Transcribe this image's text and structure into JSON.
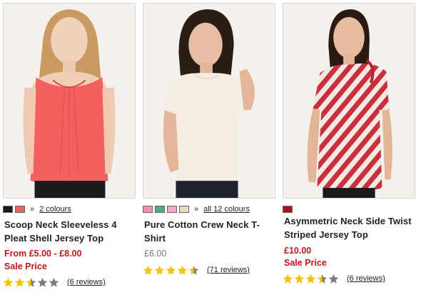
{
  "products": [
    {
      "swatches": [
        "#1a1a1a",
        "#f2605f"
      ],
      "colours_link": "2 colours",
      "title_line1": "Scoop Neck Sleeveless 4",
      "title_line2": "Pleat Shell Jersey Top",
      "price": "From £5.00 - £8.00",
      "sale": "Sale Price",
      "rating": 2.5,
      "reviews": "(6 reviews)"
    },
    {
      "swatches": [
        "#f48fb1",
        "#4caf7a",
        "#f7a8c4",
        "#e9d9c5"
      ],
      "colours_link": "all 12 colours",
      "title_line1": "Pure Cotton Crew Neck T-",
      "title_line2": "Shirt",
      "price": "£6.00",
      "rating": 4.5,
      "reviews": "(71 reviews)"
    },
    {
      "swatches": [
        "#b01020"
      ],
      "title_line1": "Asymmetric Neck Side Twist",
      "title_line2": "Striped Jersey Top",
      "price": "£10.00",
      "sale": "Sale Price",
      "rating": 3.5,
      "reviews": "(6 reviews)"
    }
  ],
  "icons": {
    "star": "star-icon",
    "raquo": "»"
  },
  "colors": {
    "price_red": "#c4161c",
    "star_gold": "#f2c200",
    "star_empty": "#7d7d7d"
  }
}
